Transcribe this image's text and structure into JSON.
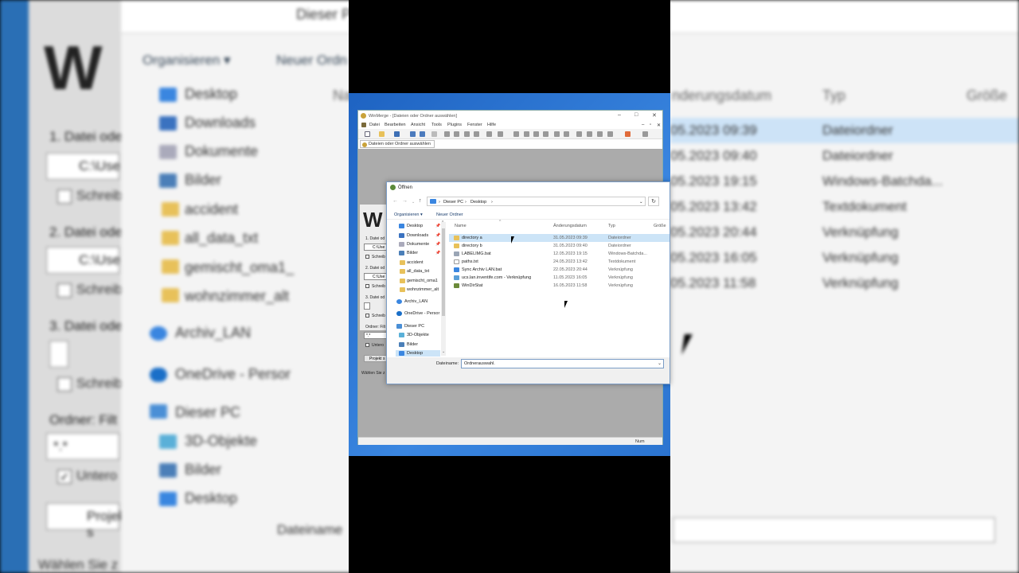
{
  "background": {
    "address_path": "Dieser P",
    "watermark_letter": "W",
    "toolbar": {
      "organize": "Organisieren ▾",
      "new_folder": "Neuer Ordn"
    },
    "nav_items": [
      "Desktop",
      "Downloads",
      "Dokumente",
      "Bilder",
      "accident",
      "all_data_txt",
      "gemischt_oma1_",
      "wohnzimmer_alt",
      "Archiv_LAN",
      "OneDrive - Persor",
      "Dieser PC",
      "3D-Objekte",
      "Bilder",
      "Desktop"
    ],
    "left_labels": [
      "1. Datei ode",
      "2. Datei ode",
      "3. Datei ode",
      "Ordner: Filt"
    ],
    "left_inputs": [
      "C:\\Use",
      "C:\\Use",
      "",
      "*.*"
    ],
    "left_checks": [
      "Schreib",
      "Schreib",
      "Schreib",
      "Untero"
    ],
    "project_button": "Projekt s",
    "columns": {
      "modified": "nderungsdatum",
      "type": "Typ",
      "size": "Größe",
      "name_partial": "Na"
    },
    "rows": [
      {
        "date": "05.2023 09:39",
        "type": "Dateiordner"
      },
      {
        "date": "05.2023 09:40",
        "type": "Dateiordner"
      },
      {
        "date": "05.2023 19:15",
        "type": "Windows-Batchda..."
      },
      {
        "date": "05.2023 13:42",
        "type": "Textdokument"
      },
      {
        "date": "05.2023 20:44",
        "type": "Verknüpfung"
      },
      {
        "date": "05.2023 16:05",
        "type": "Verknüpfung"
      },
      {
        "date": "05.2023 11:58",
        "type": "Verknüpfung"
      }
    ],
    "filename_label": "Dateiname",
    "status": "Wählen Sie z"
  },
  "winmerge": {
    "title": "WinMerge - [Dateien oder Ordner auswählen]",
    "menu": [
      "Datei",
      "Bearbeiten",
      "Ansicht",
      "Tools",
      "Plugins",
      "Fenster",
      "Hilfe"
    ],
    "tab": "Dateien oder Ordner auswählen",
    "logo_letter": "W",
    "labels": [
      "1. Datei od",
      "2. Datei od",
      "3. Datei od",
      "Ordner: Filt"
    ],
    "inputs": [
      "C:\\Use",
      "C:\\Use",
      "",
      "*.*"
    ],
    "checks": [
      "Schreib",
      "Schreib",
      "Schreib",
      "Untero"
    ],
    "project_button": "Projekt s",
    "status_left": "Wählen Sie z",
    "status_right": "Num"
  },
  "open_dialog": {
    "title": "Öffnen",
    "breadcrumb": [
      "Dieser PC",
      "Desktop"
    ],
    "commands": {
      "organize": "Organisieren ▾",
      "new_folder": "Neuer Ordner"
    },
    "nav": [
      {
        "label": "Desktop",
        "icon": "desktop-icon",
        "pinned": true
      },
      {
        "label": "Downloads",
        "icon": "download-icon",
        "pinned": true
      },
      {
        "label": "Dokumente",
        "icon": "document-icon",
        "pinned": true
      },
      {
        "label": "Bilder",
        "icon": "pictures-icon",
        "pinned": true
      },
      {
        "label": "accident",
        "icon": "folder-icon",
        "pinned": false
      },
      {
        "label": "all_data_txt",
        "icon": "folder-icon",
        "pinned": false
      },
      {
        "label": "gemischt_oma1",
        "icon": "folder-icon",
        "pinned": false
      },
      {
        "label": "wohnzimmer_alt",
        "icon": "folder-icon",
        "pinned": false
      },
      {
        "label": "Archiv_LAN",
        "icon": "network-icon",
        "pinned": false
      },
      {
        "label": "OneDrive - Persor",
        "icon": "cloud-icon",
        "pinned": false
      },
      {
        "label": "Dieser PC",
        "icon": "computer-icon",
        "pinned": false
      },
      {
        "label": "3D-Objekte",
        "icon": "cube-icon",
        "pinned": false
      },
      {
        "label": "Bilder",
        "icon": "pictures-icon",
        "pinned": false
      },
      {
        "label": "Desktop",
        "icon": "desktop-icon",
        "pinned": false
      }
    ],
    "columns": {
      "name": "Name",
      "modified": "Änderungsdatum",
      "type": "Typ",
      "size": "Größe"
    },
    "files": [
      {
        "name": "directory a",
        "date": "31.05.2023 09:39",
        "type": "Dateiordner",
        "icon": "folder-icon"
      },
      {
        "name": "directory b",
        "date": "31.05.2023 09:40",
        "type": "Dateiordner",
        "icon": "folder-icon"
      },
      {
        "name": "LABELIMG.bat",
        "date": "12.05.2023 19:15",
        "type": "Windows-Batchda...",
        "icon": "batch-file-icon"
      },
      {
        "name": "paths.txt",
        "date": "24.05.2023 13:42",
        "type": "Textdokument",
        "icon": "text-file-icon"
      },
      {
        "name": "Sync Archiv LAN.bat",
        "date": "22.05.2023 20:44",
        "type": "Verknüpfung",
        "icon": "shortcut-icon"
      },
      {
        "name": "ucs.lan.inventife.com - Verknüpfung",
        "date": "11.05.2023 16:05",
        "type": "Verknüpfung",
        "icon": "shortcut-icon"
      },
      {
        "name": "WinDirStat",
        "date": "16.05.2023 11:58",
        "type": "Verknüpfung",
        "icon": "shortcut-icon"
      }
    ],
    "filename_label": "Dateiname:",
    "filename_value": "Ordnerauswahl."
  },
  "colors": {
    "desktop_blue": "#2b74d0",
    "selection": "#cce4f7",
    "folder": "#e8c15a"
  }
}
